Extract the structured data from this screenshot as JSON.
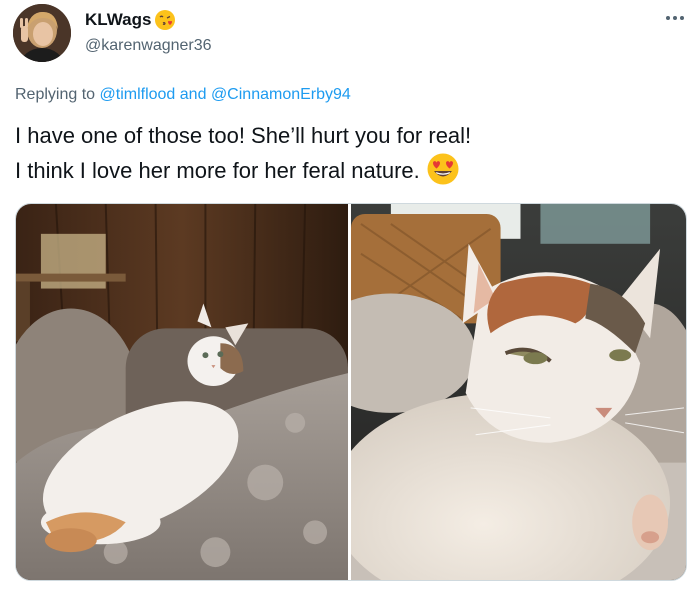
{
  "author": {
    "display_name": "KLWags",
    "name_emoji": "kissing-face-with-heart-emoji",
    "handle": "@karenwagner36",
    "avatar": "avatar-photo"
  },
  "reply": {
    "prefix": "Replying to",
    "mention_1": "@timlflood",
    "conjunction": "and",
    "mention_2": "@CinnamonErby94"
  },
  "tweet": {
    "line_1": "I have one of those too! She’ll hurt you for real!",
    "line_2": "I think I love her more for her feral nature.",
    "emoji": "smiling-face-with-heart-eyes"
  },
  "media": {
    "photos": [
      {
        "name": "photo-cat-lying-on-blanket"
      },
      {
        "name": "photo-cat-closeup"
      }
    ]
  },
  "colors": {
    "link": "#1d9bf0",
    "secondary_text": "#536471",
    "primary_text": "#0f1419",
    "border": "#cfd9de"
  },
  "icons": {
    "more": "more-dots-icon"
  }
}
